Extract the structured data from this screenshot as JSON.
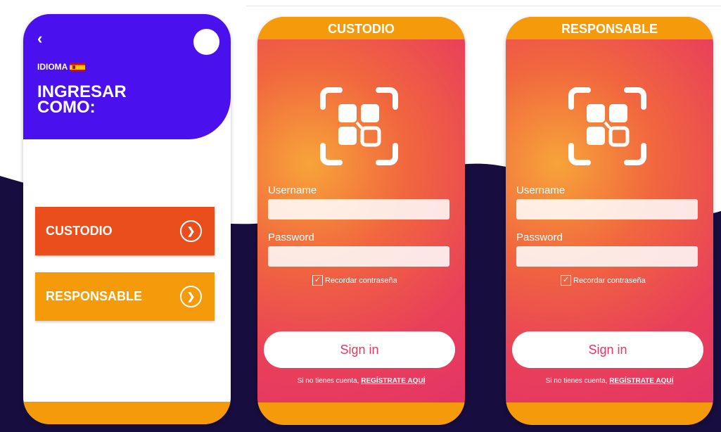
{
  "selector": {
    "back_icon": "chevron-left-icon",
    "language_label": "IDIOMA",
    "flag_icon": "spain-flag-icon",
    "title": "INGRESAR COMO:",
    "roles": [
      {
        "label": "CUSTODIO",
        "color": "#ea4e1c",
        "icon": "chevron-right-circle-icon"
      },
      {
        "label": "RESPONSABLE",
        "color": "#f59a0a",
        "icon": "chevron-right-circle-icon"
      }
    ]
  },
  "login_custodio": {
    "header": "CUSTODIO",
    "username_label": "Username",
    "password_label": "Password",
    "remember_label": "Recordar contraseña",
    "remember_checked": true,
    "signin_label": "Sign in",
    "register_prompt": "Si no tienes cuenta,",
    "register_link": "REGÍSTRATE AQUÍ"
  },
  "login_responsable": {
    "header": "RESPONSABLE",
    "username_label": "Username",
    "password_label": "Password",
    "remember_label": "Recordar contraseña",
    "remember_checked": true,
    "signin_label": "Sign in",
    "register_prompt": "Si no tienes cuenta,",
    "register_link": "REGÍSTRATE AQUÍ"
  },
  "colors": {
    "purple": "#4a11ee",
    "orange": "#f59a0a",
    "red_orange": "#ea4e1c",
    "navy": "#170d3f",
    "pink": "#e23268"
  }
}
